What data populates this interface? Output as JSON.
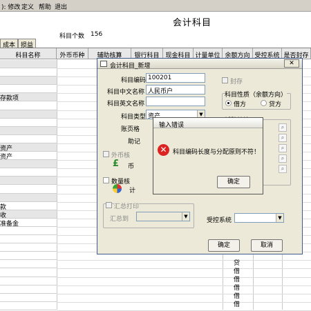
{
  "menu": [
    "): 修改",
    "定义",
    "帮助",
    "退出"
  ],
  "page": {
    "title": "会计科目",
    "count_label": "科目个数",
    "count_value": "156"
  },
  "tabs": [
    "成本",
    "损益"
  ],
  "grid": {
    "headers": [
      "科目名称",
      "外币币种",
      "辅助核算",
      "银行科目",
      "现金科目",
      "计量单位",
      "余额方向",
      "受控系统",
      "是否封存"
    ],
    "left_rows": [
      "",
      "",
      "",
      "",
      "存款项",
      "",
      "",
      "",
      "",
      "",
      "资产",
      "资产",
      "",
      "",
      "",
      "",
      "",
      "款",
      "收",
      "准备金"
    ],
    "bottom_left": [
      "",
      "",
      "",
      "",
      "",
      "",
      ""
    ],
    "directions": [
      "贷",
      "借",
      "借",
      "借",
      "借",
      "借",
      "借"
    ]
  },
  "dialog": {
    "title": "会计科目_新增",
    "code_label": "科目编码",
    "code_value": "100201",
    "cn_name_label": "科目中文名称",
    "cn_name_value": "人民币户",
    "en_name_label": "科目英文名称",
    "en_name_value": "",
    "type_label": "科目类型",
    "type_value": "资产",
    "page_format_label": "账页格",
    "mnemonic_label": "助记",
    "seal_label": "封存",
    "nature_label": "科目性质（余额方向）",
    "debit_label": "借方",
    "credit_label": "贷方",
    "aux_label": "辅助核算",
    "foreign_label": "外币核",
    "foreign_sub": "币",
    "qty_label": "数量核",
    "qty_sub": "计",
    "summary_print_label": "汇总打印",
    "summary_to_label": "汇总到",
    "control_label": "受控系统",
    "ok_label": "确定",
    "cancel_label": "取消"
  },
  "error_dialog": {
    "title": "输入错误",
    "message": "科目编码长度与分配原则不符！",
    "ok_label": "确定"
  }
}
